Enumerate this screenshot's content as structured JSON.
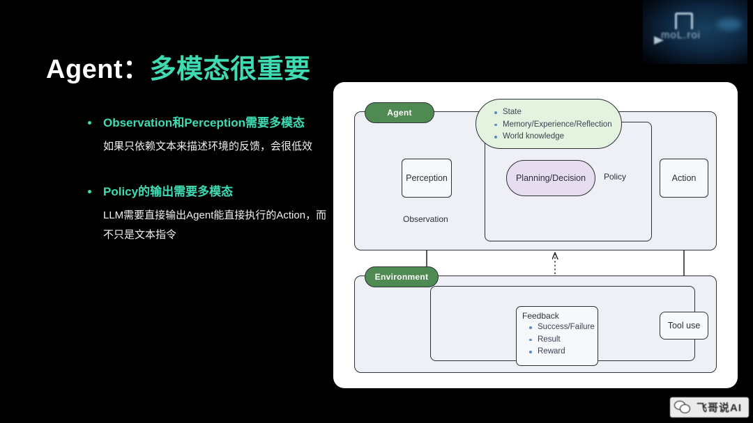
{
  "slide": {
    "background_color": "#000000",
    "accent_color": "#3fdcb4",
    "title_plain": "Agent：",
    "title_accent": "多模态很重要"
  },
  "brand": {
    "name": "moL.roi"
  },
  "bullets": [
    {
      "heading": "Observation和Perception需要多模态",
      "body": "如果只依赖文本来描述环境的反馈，会很低效"
    },
    {
      "heading": "Policy的输出需要多模态",
      "body": "LLM需要直接输出Agent能直接执行的Action，而不只是文本指令"
    }
  ],
  "diagram": {
    "agent_section_label": "Agent",
    "environment_section_label": "Environment",
    "state_items": [
      "State",
      "Memory/Experience/Reflection",
      "World knowledge"
    ],
    "perception_label": "Perception",
    "planning_label": "Planning/Decision",
    "action_label": "Action",
    "tool_use_label": "Tool use",
    "observation_label": "Observation",
    "policy_label": "Policy",
    "feedback_title": "Feedback",
    "feedback_items": [
      "Success/Failure",
      "Result",
      "Reward"
    ],
    "colors": {
      "section_fill": "#eef0f6",
      "pill_fill": "#4e8a52",
      "state_fill": "#e4f2e0",
      "planning_fill": "#e7ddf0",
      "stroke": "#2b2f36"
    },
    "watermarks": [
      "飞哥说AI",
      "飞哥说AI",
      "飞哥说AI",
      "飞哥说AI",
      "飞哥说AI",
      "飞哥说AI",
      "飞哥说AI",
      "飞哥说AI"
    ]
  },
  "watermark": {
    "text": "飞哥说AI"
  }
}
